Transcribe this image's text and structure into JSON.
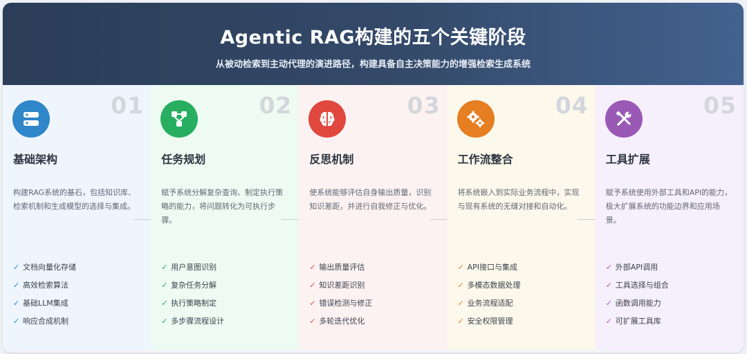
{
  "header": {
    "title": "Agentic RAG构建的五个关键阶段",
    "subtitle": "从被动检索到主动代理的演进路径，构建具备自主决策能力的增强检索生成系统"
  },
  "stages": [
    {
      "number": "01",
      "icon": "server-icon",
      "color": "#2f86c8",
      "title": "基础架构",
      "desc": "构建RAG系统的基石，包括知识库、检索机制和生成模型的选择与集成。",
      "features": [
        "文档向量化存储",
        "高效检索算法",
        "基础LLM集成",
        "响应合成机制"
      ]
    },
    {
      "number": "02",
      "icon": "flowchart-icon",
      "color": "#27ae60",
      "title": "任务规划",
      "desc": "赋予系统分解复杂查询、制定执行策略的能力，将问题转化为可执行步骤。",
      "features": [
        "用户意图识别",
        "复杂任务分解",
        "执行策略制定",
        "多步骤流程设计"
      ]
    },
    {
      "number": "03",
      "icon": "brain-icon",
      "color": "#e0483e",
      "title": "反思机制",
      "desc": "使系统能够评估自身输出质量，识别知识差距，并进行自我修正与优化。",
      "features": [
        "输出质量评估",
        "知识差距识别",
        "错误检测与修正",
        "多轮迭代优化"
      ]
    },
    {
      "number": "04",
      "icon": "gears-icon",
      "color": "#e67e22",
      "title": "工作流整合",
      "desc": "将系统嵌入到实际业务流程中，实现与现有系统的无缝对接和自动化。",
      "features": [
        "API接口与集成",
        "多模态数据处理",
        "业务流程适配",
        "安全权限管理"
      ]
    },
    {
      "number": "05",
      "icon": "tools-icon",
      "color": "#9b59b6",
      "title": "工具扩展",
      "desc": "赋予系统使用外部工具和API的能力，极大扩展系统的功能边界和应用场景。",
      "features": [
        "外部API调用",
        "工具选择与组合",
        "函数调用能力",
        "可扩展工具库"
      ]
    }
  ],
  "check_glyph": "✓"
}
